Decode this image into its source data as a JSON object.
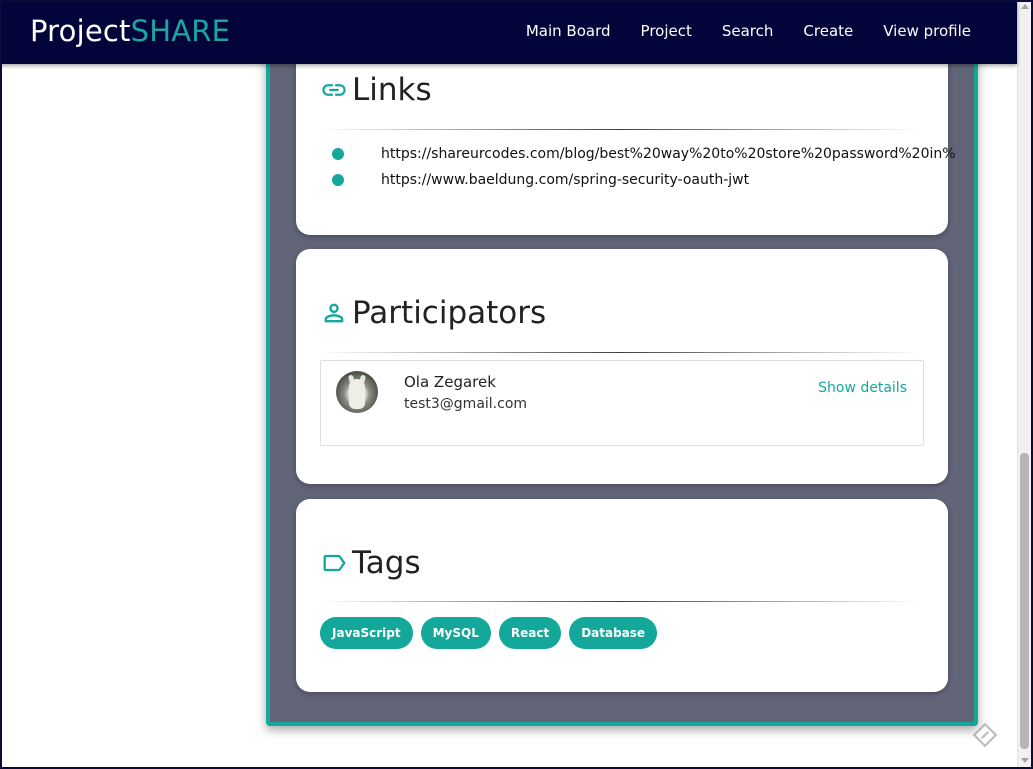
{
  "navbar": {
    "brand_main": "Project",
    "brand_accent": "SHARE",
    "items": [
      {
        "label": "Main Board"
      },
      {
        "label": "Project"
      },
      {
        "label": "Search"
      },
      {
        "label": "Create"
      },
      {
        "label": "View profile"
      }
    ]
  },
  "links": {
    "title": "Links",
    "icon": "link-icon",
    "items": [
      {
        "url": "https://shareurcodes.com/blog/best%20way%20to%20store%20password%20in%"
      },
      {
        "url": "https://www.baeldung.com/spring-security-oauth-jwt"
      }
    ]
  },
  "participators": {
    "title": "Participators",
    "icon": "person-icon",
    "items": [
      {
        "name": "Ola Zegarek",
        "email": "test3@gmail.com",
        "action": "Show details"
      }
    ]
  },
  "tags": {
    "title": "Tags",
    "icon": "label-icon",
    "items": [
      {
        "label": "JavaScript"
      },
      {
        "label": "MySQL"
      },
      {
        "label": "React"
      },
      {
        "label": "Database"
      }
    ]
  },
  "colors": {
    "navbar_bg": "#03043a",
    "accent": "#14a89a",
    "panel_bg": "#626478"
  }
}
